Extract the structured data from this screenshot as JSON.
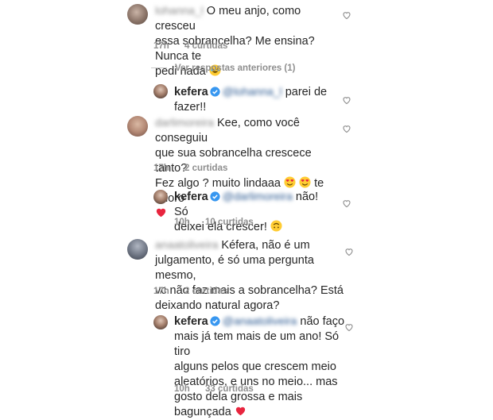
{
  "comments": [
    {
      "username": "lohanna_l",
      "lines": [
        "O meu anjo, como cresceu",
        "essa sobrancelha? Me ensina? Nunca te",
        "pedi nada"
      ],
      "time": "17h",
      "likes": "4 curtidas"
    },
    {
      "username": "kefera",
      "mention": "@lohanna_l",
      "lines": [
        "parei de",
        "fazer!!"
      ]
    },
    {
      "username": "darlimoreira",
      "lines": [
        "Kee, como você  conseguiu",
        "que sua sobrancelha crescece tanto?",
        "Fez algo ? muito lindaaa",
        "te adoro"
      ],
      "time": "17h",
      "likes": "2 curtidas"
    },
    {
      "username": "kefera",
      "mention": "@darlimoreira",
      "lines": [
        "não! Só",
        "deixei ela crescer!"
      ],
      "time": "10h",
      "likes": "10 curtidas"
    },
    {
      "username": "anaatoliveira",
      "lines": [
        "Kéfera, não é um",
        "julgamento, é só uma pergunta mesmo,",
        "vc não faz mais a sobrancelha? Está",
        "deixando natural agora?"
      ],
      "time": "17h",
      "likes": "2 curtidas"
    },
    {
      "username": "kefera",
      "mention": "@anaatoliveira",
      "lines": [
        "não faço",
        "mais já tem mais de um ano! Só tiro",
        "alguns pelos que crescem meio",
        "aleatórios, e uns no meio... mas",
        "gosto dela grossa e mais",
        "bagunçada"
      ],
      "time": "10h",
      "likes": "33 curtidas"
    }
  ],
  "view_replies": "Ver respostas anteriores (1)",
  "colors": {
    "heart_red": "#ed4956",
    "verified_blue": "#3897f0",
    "meta_gray": "#8e8e8e"
  }
}
